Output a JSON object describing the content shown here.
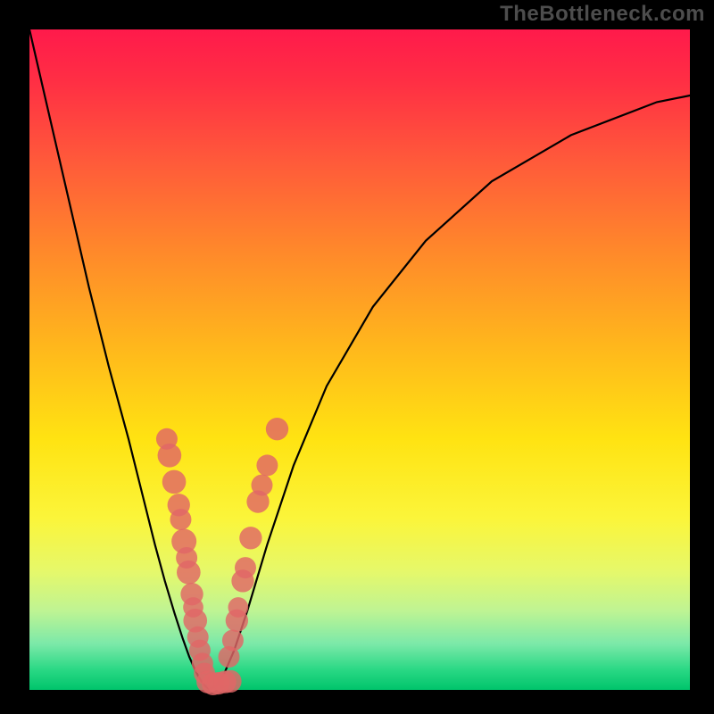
{
  "watermark": "TheBottleneck.com",
  "colors": {
    "page_bg": "#000000",
    "watermark_text": "#4d4d4d",
    "curve_stroke": "#000000",
    "marker_fill": "#e06666",
    "gradient_stops": [
      "#ff1a4b",
      "#ff2f44",
      "#ff5a3a",
      "#ff8a2a",
      "#ffb71c",
      "#ffe312",
      "#fbf53a",
      "#e6f86a",
      "#bff493",
      "#7ce9a9",
      "#29d884",
      "#00c46b"
    ]
  },
  "chart_data": {
    "type": "line",
    "title": "",
    "xlabel": "",
    "ylabel": "",
    "xlim": [
      0,
      100
    ],
    "ylim": [
      0,
      100
    ],
    "grid": false,
    "legend": false,
    "series": [
      {
        "name": "left-curve",
        "x": [
          0,
          3,
          6,
          9,
          12,
          15,
          17,
          19,
          20.5,
          22,
          23.2,
          24.2,
          25,
          25.6,
          26.2,
          26.8,
          27.3
        ],
        "y": [
          100,
          87,
          74,
          61,
          49,
          38,
          30,
          22,
          16.5,
          11.5,
          7.8,
          5.0,
          3.2,
          2.0,
          1.1,
          0.4,
          0.1
        ]
      },
      {
        "name": "right-curve",
        "x": [
          27.3,
          28.2,
          29.5,
          31,
          33,
          36,
          40,
          45,
          52,
          60,
          70,
          82,
          95,
          100
        ],
        "y": [
          0.1,
          0.6,
          2.5,
          6.0,
          12,
          22,
          34,
          46,
          58,
          68,
          77,
          84,
          89,
          90
        ]
      }
    ],
    "markers": [
      {
        "x": 20.8,
        "y": 38.0,
        "r": 1.2
      },
      {
        "x": 21.2,
        "y": 35.5,
        "r": 1.4
      },
      {
        "x": 21.9,
        "y": 31.5,
        "r": 1.4
      },
      {
        "x": 22.6,
        "y": 28.0,
        "r": 1.3
      },
      {
        "x": 22.9,
        "y": 25.8,
        "r": 1.2
      },
      {
        "x": 23.4,
        "y": 22.5,
        "r": 1.5
      },
      {
        "x": 23.8,
        "y": 20.0,
        "r": 1.2
      },
      {
        "x": 24.1,
        "y": 17.8,
        "r": 1.4
      },
      {
        "x": 24.6,
        "y": 14.5,
        "r": 1.3
      },
      {
        "x": 24.8,
        "y": 12.5,
        "r": 1.1
      },
      {
        "x": 25.1,
        "y": 10.5,
        "r": 1.4
      },
      {
        "x": 25.5,
        "y": 8.0,
        "r": 1.2
      },
      {
        "x": 25.8,
        "y": 6.0,
        "r": 1.2
      },
      {
        "x": 26.2,
        "y": 4.0,
        "r": 1.2
      },
      {
        "x": 26.5,
        "y": 2.5,
        "r": 1.2
      },
      {
        "x": 27.0,
        "y": 1.2,
        "r": 1.3
      },
      {
        "x": 27.8,
        "y": 0.9,
        "r": 1.3
      },
      {
        "x": 28.6,
        "y": 1.0,
        "r": 1.3
      },
      {
        "x": 29.6,
        "y": 1.2,
        "r": 1.3
      },
      {
        "x": 30.4,
        "y": 1.3,
        "r": 1.3
      },
      {
        "x": 30.2,
        "y": 5.0,
        "r": 1.2
      },
      {
        "x": 30.8,
        "y": 7.5,
        "r": 1.2
      },
      {
        "x": 31.4,
        "y": 10.5,
        "r": 1.3
      },
      {
        "x": 31.6,
        "y": 12.5,
        "r": 1.1
      },
      {
        "x": 32.3,
        "y": 16.5,
        "r": 1.3
      },
      {
        "x": 32.7,
        "y": 18.5,
        "r": 1.2
      },
      {
        "x": 33.5,
        "y": 23.0,
        "r": 1.3
      },
      {
        "x": 34.6,
        "y": 28.5,
        "r": 1.3
      },
      {
        "x": 35.2,
        "y": 31.0,
        "r": 1.2
      },
      {
        "x": 36.0,
        "y": 34.0,
        "r": 1.2
      },
      {
        "x": 37.5,
        "y": 39.5,
        "r": 1.3
      }
    ]
  }
}
